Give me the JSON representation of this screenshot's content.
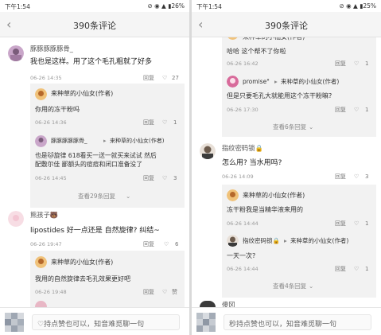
{
  "left": {
    "status": {
      "time": "下午1:54",
      "icons": "⊘ ◉ ▲ ▮26%"
    },
    "title": "390条评论",
    "items": [
      {
        "name": "豚豚豚豚豚骨_",
        "text": "我也是这样。用了这个毛孔粗就了好多",
        "time": "06-26 14:35",
        "reply": "回复",
        "likes": "27"
      },
      {
        "name": "来种草的小仙女(作者)",
        "text": "你用的冻干粉吗",
        "time": "06-26 14:36",
        "reply": "回复",
        "likes": "1"
      },
      {
        "name": "豚豚豚豚豚骨_",
        "to": "来种草的小仙女(作者)",
        "text1": "也是🐱旋律 618看买一送一就买来试试 然后",
        "text2": "配敷尔佳 鄙额头的痘痘和闭口准备没了",
        "time": "06-26 14:45",
        "reply": "回复",
        "likes": "3"
      },
      {
        "more": "查看29条回复"
      },
      {
        "name": "熊孩子🐻",
        "text": "lipostides 好一点还是 自然旋律? 纠结~",
        "time": "06-26 19:47",
        "reply": "回复",
        "likes": "6"
      },
      {
        "name": "来种草的小仙女(作者)",
        "text": "我用的自然旋律去毛孔效果更好吧",
        "time": "06-26 19:48",
        "reply": "回复",
        "likes": "赞"
      }
    ],
    "placeholder": "♡持点赞也可以，知音难觅聊一句"
  },
  "right": {
    "status": {
      "time": "下午1:54",
      "icons": "⊘ ◉ ▲ ▮25%"
    },
    "title": "390条评论",
    "items": [
      {
        "name": "来种草的小仙女(作者)",
        "text": "哈哈 这个帮不了你啦",
        "time": "06-26 16:42",
        "reply": "回复",
        "likes": "1"
      },
      {
        "name": "promise°",
        "to": "来种草的小仙女(作者)",
        "text": "但是只要毛孔大就能用这个冻干粉嘛?",
        "time": "06-26 17:30",
        "reply": "回复",
        "likes": "1"
      },
      {
        "more": "查看6条回复"
      },
      {
        "name": "指纹密码锁🔒",
        "text": "怎么用? 当水用吗?",
        "time": "06-26 14:09",
        "reply": "回复",
        "likes": "3"
      },
      {
        "name": "来种草的小仙女(作者)",
        "text": "冻干粉我是当精华液来用的",
        "time": "06-26 14:44",
        "reply": "回复",
        "likes": "1"
      },
      {
        "name": "指纹密码锁🔒",
        "to": "来种草的小仙女(作者)",
        "text": "一天一次?",
        "time": "06-26 14:44",
        "reply": "回复",
        "likes": "1"
      },
      {
        "more": "查看4条回复"
      },
      {
        "name": "傻冈"
      }
    ],
    "placeholder": "秒持点赞也可以，知音难觅聊一句"
  }
}
